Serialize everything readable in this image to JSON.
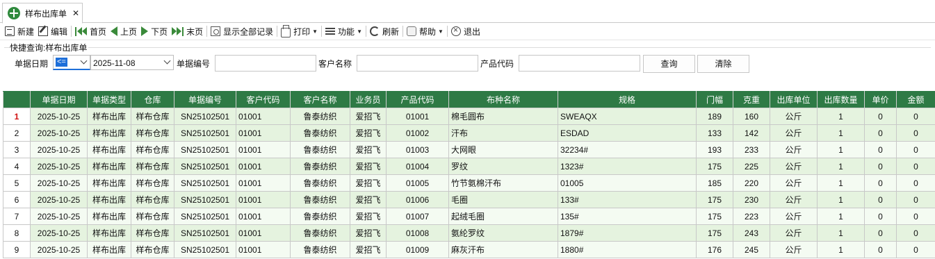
{
  "tab": {
    "title": "样布出库单",
    "close": "✕"
  },
  "toolbar": {
    "new": "新建",
    "edit": "编辑",
    "first": "首页",
    "prev": "上页",
    "next": "下页",
    "last": "末页",
    "show_all": "显示全部记录",
    "print": "打印",
    "func": "功能",
    "refresh": "刷新",
    "help": "帮助",
    "exit": "退出"
  },
  "quick": {
    "legend": "快捷查询:样布出库单",
    "date_label": "单据日期",
    "date_op": "<=",
    "date_value": "2025-11-08",
    "doc_no_label": "单据编号",
    "doc_no_value": "",
    "customer_label": "客户名称",
    "customer_value": "",
    "product_label": "产品代码",
    "product_value": "",
    "query_btn": "查询",
    "clear_btn": "清除"
  },
  "grid": {
    "headers": [
      "单据日期",
      "单据类型",
      "仓库",
      "单据编号",
      "客户代码",
      "客户名称",
      "业务员",
      "产品代码",
      "布种名称",
      "规格",
      "门幅",
      "克重",
      "出库单位",
      "出库数量",
      "单价",
      "金额"
    ],
    "rows": [
      {
        "n": "1",
        "date": "2025-10-25",
        "type": "样布出库",
        "wh": "样布仓库",
        "no": "SN25102501",
        "cust_code": "01001",
        "cust_name": "鲁泰纺织",
        "sales": "爱招飞",
        "prod": "01001",
        "fabric": "棉毛圆布",
        "spec": "SWEAQX",
        "width": "189",
        "gsm": "160",
        "unit": "公斤",
        "qty": "1",
        "price": "0",
        "amount": "0"
      },
      {
        "n": "2",
        "date": "2025-10-25",
        "type": "样布出库",
        "wh": "样布仓库",
        "no": "SN25102501",
        "cust_code": "01001",
        "cust_name": "鲁泰纺织",
        "sales": "爱招飞",
        "prod": "01002",
        "fabric": "汗布",
        "spec": "ESDAD",
        "width": "133",
        "gsm": "142",
        "unit": "公斤",
        "qty": "1",
        "price": "0",
        "amount": "0"
      },
      {
        "n": "3",
        "date": "2025-10-25",
        "type": "样布出库",
        "wh": "样布仓库",
        "no": "SN25102501",
        "cust_code": "01001",
        "cust_name": "鲁泰纺织",
        "sales": "爱招飞",
        "prod": "01003",
        "fabric": "大网眼",
        "spec": "32234#",
        "width": "193",
        "gsm": "233",
        "unit": "公斤",
        "qty": "1",
        "price": "0",
        "amount": "0"
      },
      {
        "n": "4",
        "date": "2025-10-25",
        "type": "样布出库",
        "wh": "样布仓库",
        "no": "SN25102501",
        "cust_code": "01001",
        "cust_name": "鲁泰纺织",
        "sales": "爱招飞",
        "prod": "01004",
        "fabric": "罗纹",
        "spec": "1323#",
        "width": "175",
        "gsm": "225",
        "unit": "公斤",
        "qty": "1",
        "price": "0",
        "amount": "0"
      },
      {
        "n": "5",
        "date": "2025-10-25",
        "type": "样布出库",
        "wh": "样布仓库",
        "no": "SN25102501",
        "cust_code": "01001",
        "cust_name": "鲁泰纺织",
        "sales": "爱招飞",
        "prod": "01005",
        "fabric": "竹节氨棉汗布",
        "spec": "01005",
        "width": "185",
        "gsm": "220",
        "unit": "公斤",
        "qty": "1",
        "price": "0",
        "amount": "0"
      },
      {
        "n": "6",
        "date": "2025-10-25",
        "type": "样布出库",
        "wh": "样布仓库",
        "no": "SN25102501",
        "cust_code": "01001",
        "cust_name": "鲁泰纺织",
        "sales": "爱招飞",
        "prod": "01006",
        "fabric": "毛圈",
        "spec": "133#",
        "width": "175",
        "gsm": "230",
        "unit": "公斤",
        "qty": "1",
        "price": "0",
        "amount": "0"
      },
      {
        "n": "7",
        "date": "2025-10-25",
        "type": "样布出库",
        "wh": "样布仓库",
        "no": "SN25102501",
        "cust_code": "01001",
        "cust_name": "鲁泰纺织",
        "sales": "爱招飞",
        "prod": "01007",
        "fabric": "起绒毛圈",
        "spec": "135#",
        "width": "175",
        "gsm": "223",
        "unit": "公斤",
        "qty": "1",
        "price": "0",
        "amount": "0"
      },
      {
        "n": "8",
        "date": "2025-10-25",
        "type": "样布出库",
        "wh": "样布仓库",
        "no": "SN25102501",
        "cust_code": "01001",
        "cust_name": "鲁泰纺织",
        "sales": "爱招飞",
        "prod": "01008",
        "fabric": "氨纶罗纹",
        "spec": "1879#",
        "width": "175",
        "gsm": "243",
        "unit": "公斤",
        "qty": "1",
        "price": "0",
        "amount": "0"
      },
      {
        "n": "9",
        "date": "2025-10-25",
        "type": "样布出库",
        "wh": "样布仓库",
        "no": "SN25102501",
        "cust_code": "01001",
        "cust_name": "鲁泰纺织",
        "sales": "爱招飞",
        "prod": "01009",
        "fabric": "麻灰汗布",
        "spec": "1880#",
        "width": "176",
        "gsm": "245",
        "unit": "公斤",
        "qty": "1",
        "price": "0",
        "amount": "0"
      }
    ]
  },
  "colors": {
    "header_bg": "#2e7a45",
    "row_light": "#f4fbf2",
    "row_dark": "#e5f3df",
    "selected_marker": "#d01010",
    "accent": "#1e6fd9"
  }
}
